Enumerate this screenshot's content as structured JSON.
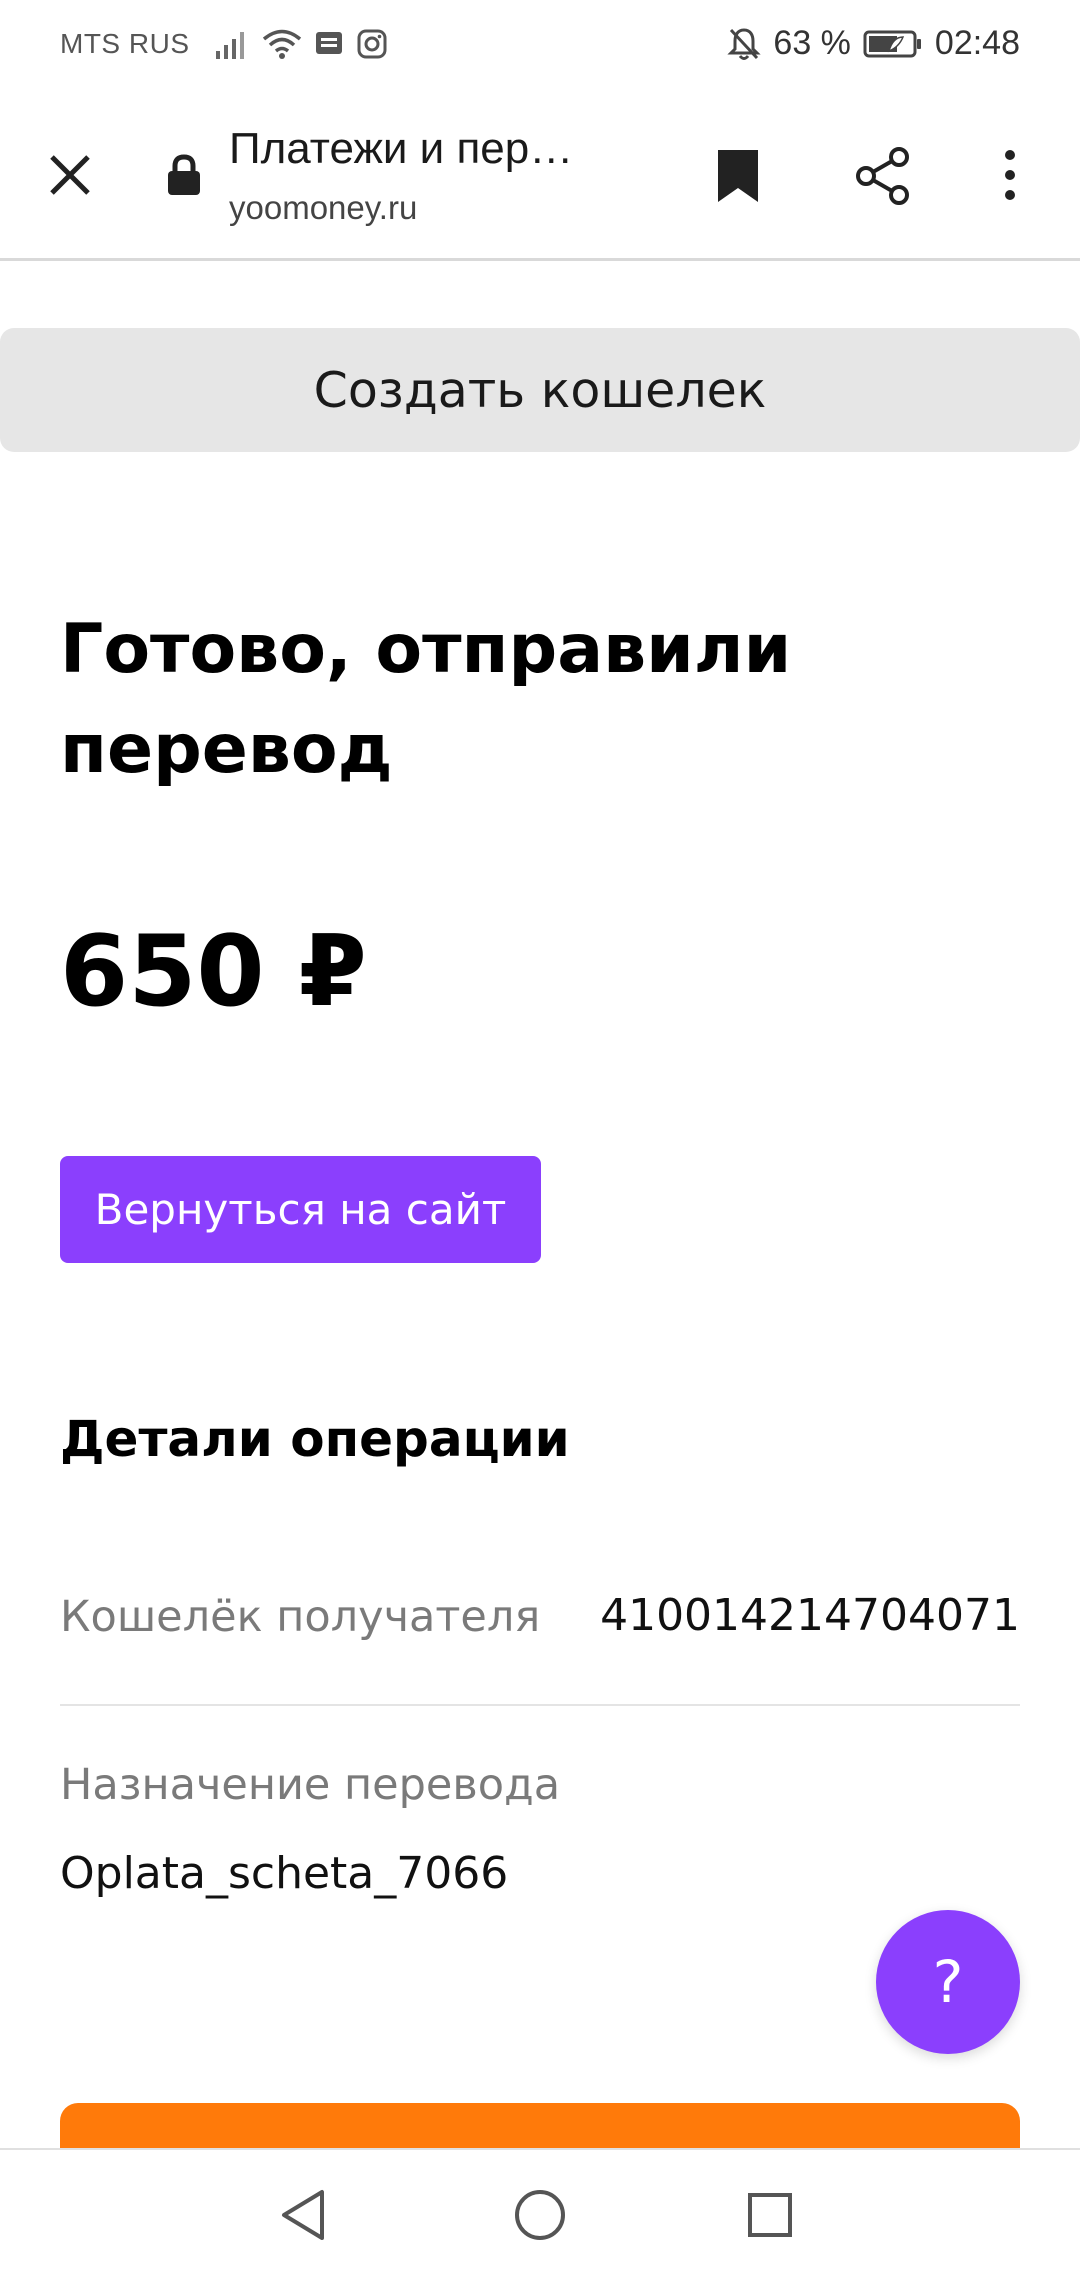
{
  "status_bar": {
    "carrier": "MTS RUS",
    "battery": "63 %",
    "time": "02:48"
  },
  "toolbar": {
    "title": "Платежи и пер…",
    "url": "yoomoney.ru"
  },
  "create_wallet_label": "Создать кошелек",
  "heading": "Готово, отправили перевод",
  "amount": "650 ₽",
  "back_button_label": "Вернуться на сайт",
  "details": {
    "title": "Детали операции",
    "rows": [
      {
        "label": "Кошелёк получателя",
        "value": "410014214704071"
      },
      {
        "label": "Назначение перевода",
        "value": "Oplata_scheta_7066"
      }
    ]
  },
  "help_label": "?",
  "colors": {
    "accent": "#8b3ffd",
    "orange": "#ff7a0a",
    "gray_button": "#e6e6e6"
  }
}
